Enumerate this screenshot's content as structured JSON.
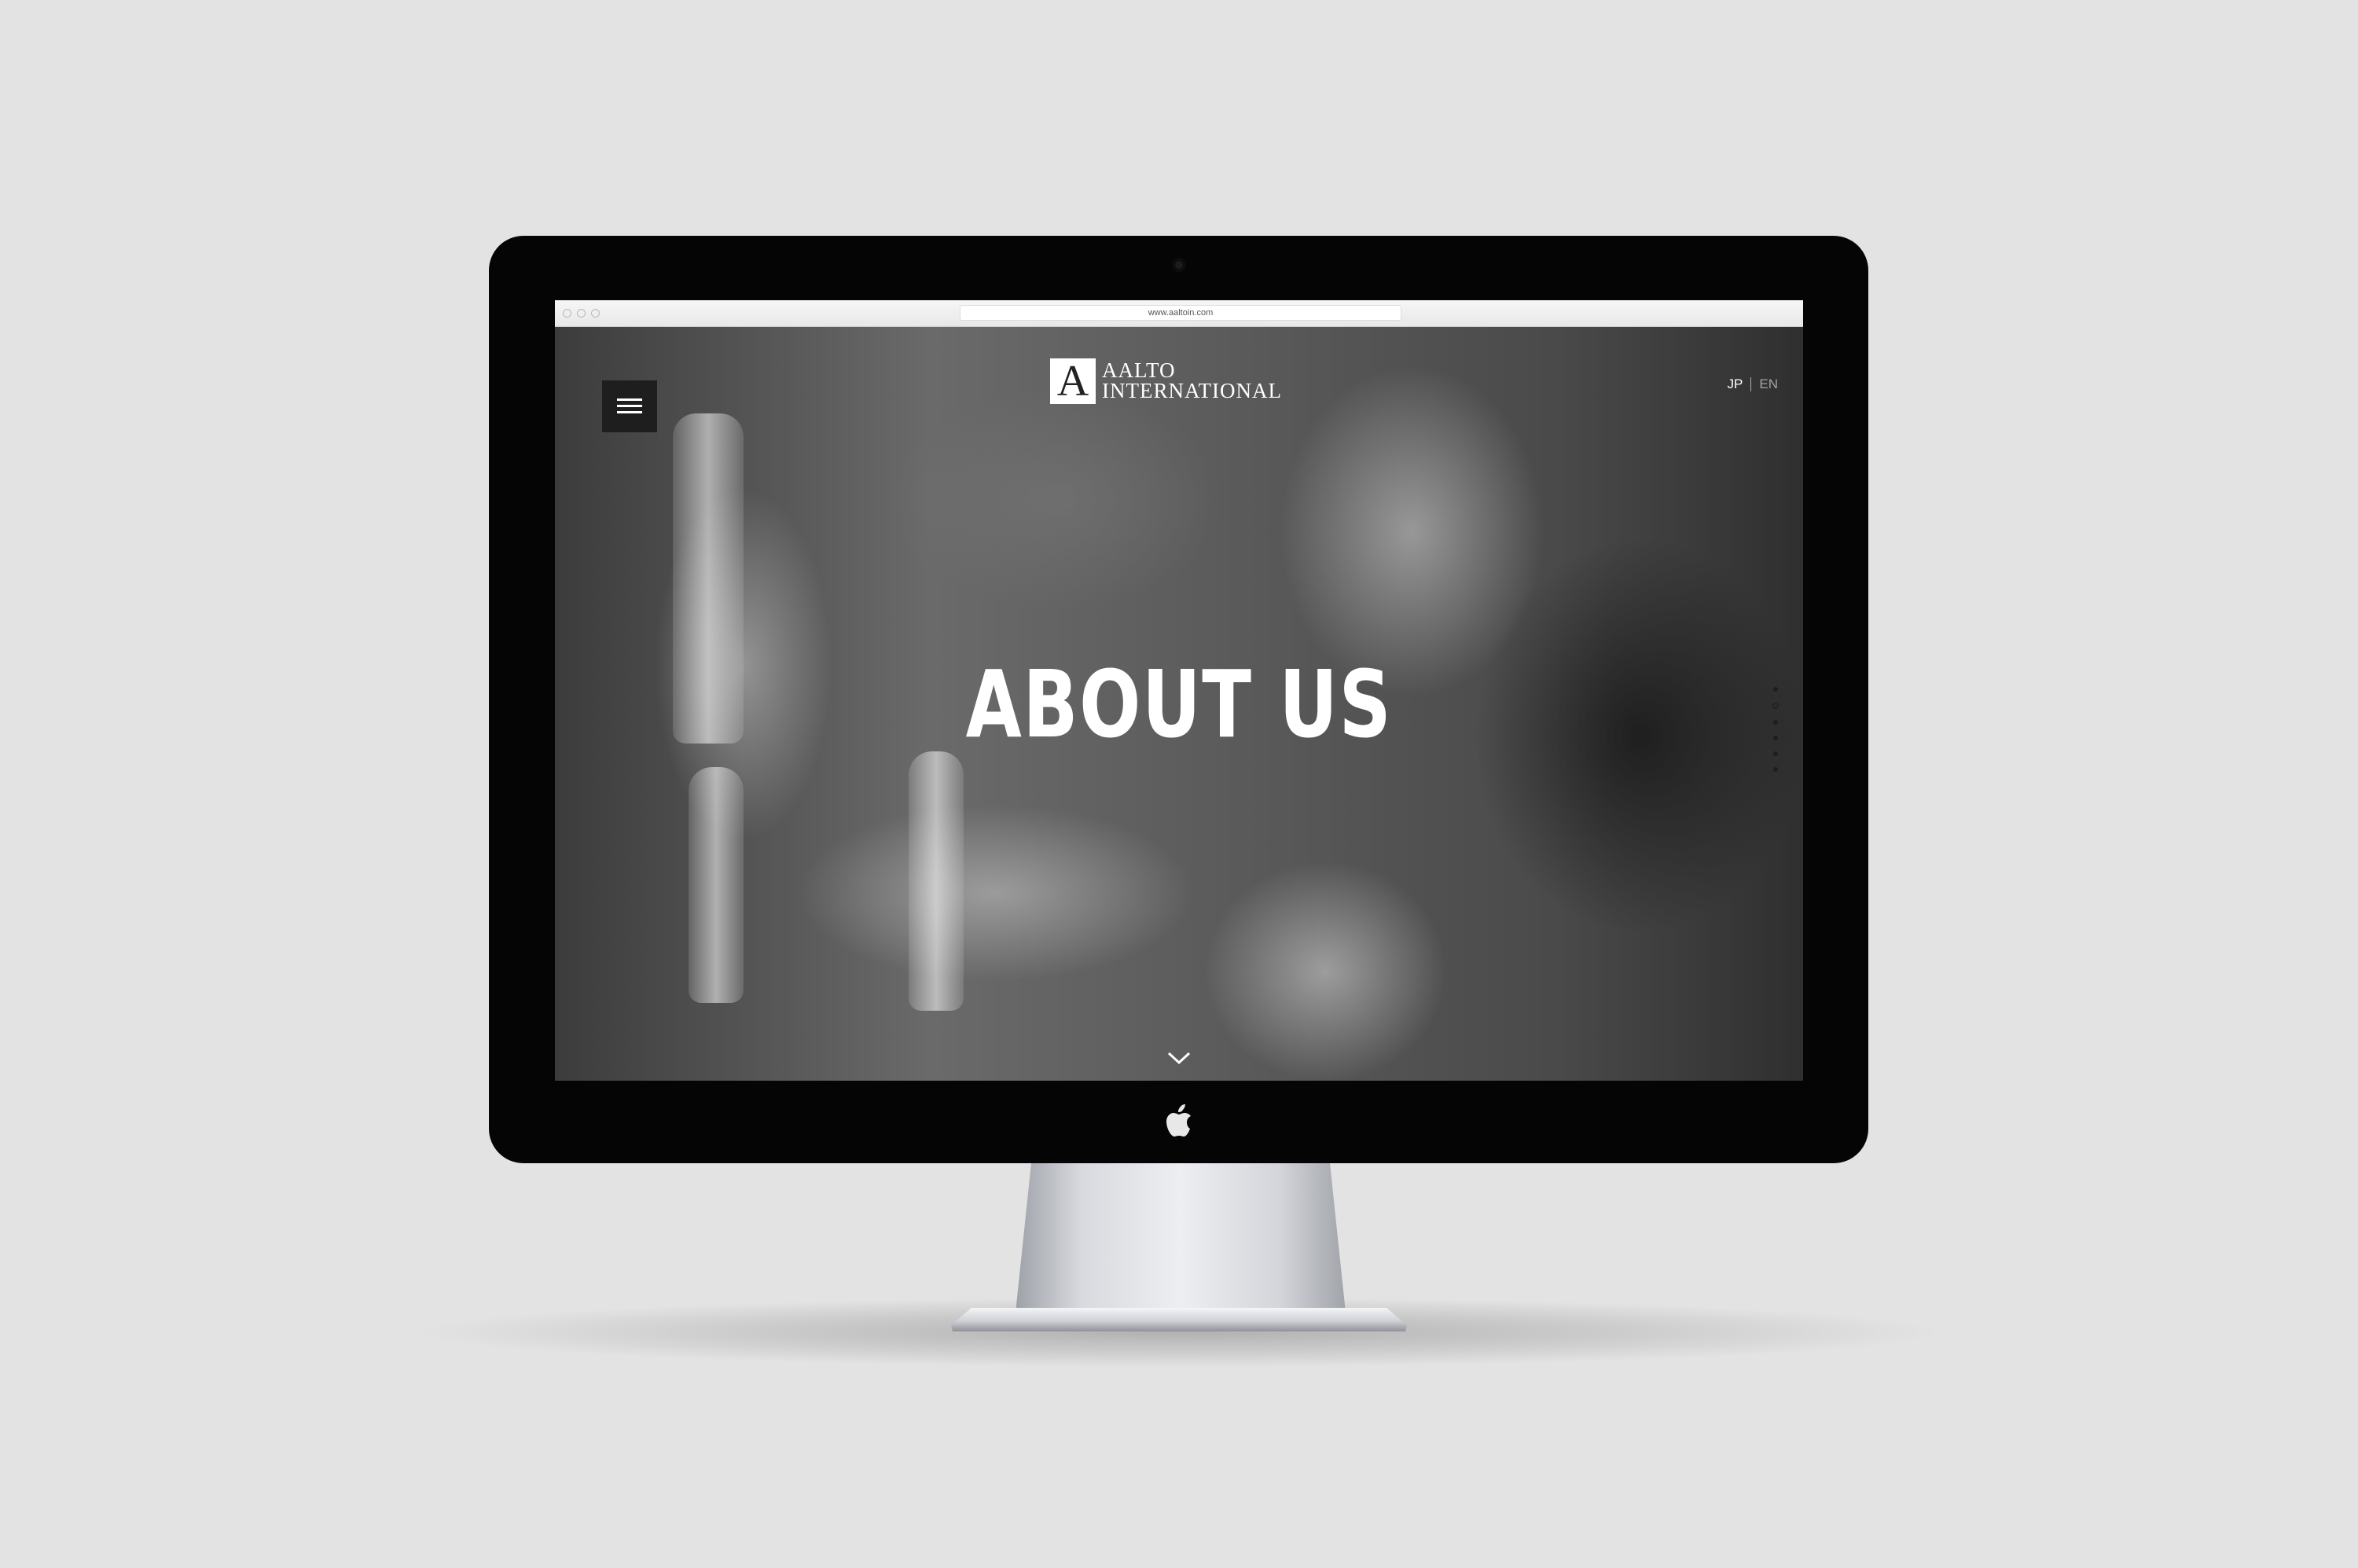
{
  "browser": {
    "url": "www.aaltoin.com"
  },
  "header": {
    "menu_icon": "hamburger-menu-icon",
    "logo_mark": "A",
    "logo_line1": "AALTO",
    "logo_line2": "INTERNATIONAL",
    "languages": [
      "JP",
      "EN"
    ]
  },
  "hero": {
    "title": "ABOUT US",
    "scroll_icon": "chevron-down-icon",
    "section_dots": 6,
    "active_dot": 1
  },
  "device": {
    "brand_icon": "apple-logo-icon"
  },
  "colors": {
    "background": "#e3e3e3",
    "bezel": "#050505",
    "menu_button": "#1e1e1e",
    "title": "#ffffff"
  }
}
